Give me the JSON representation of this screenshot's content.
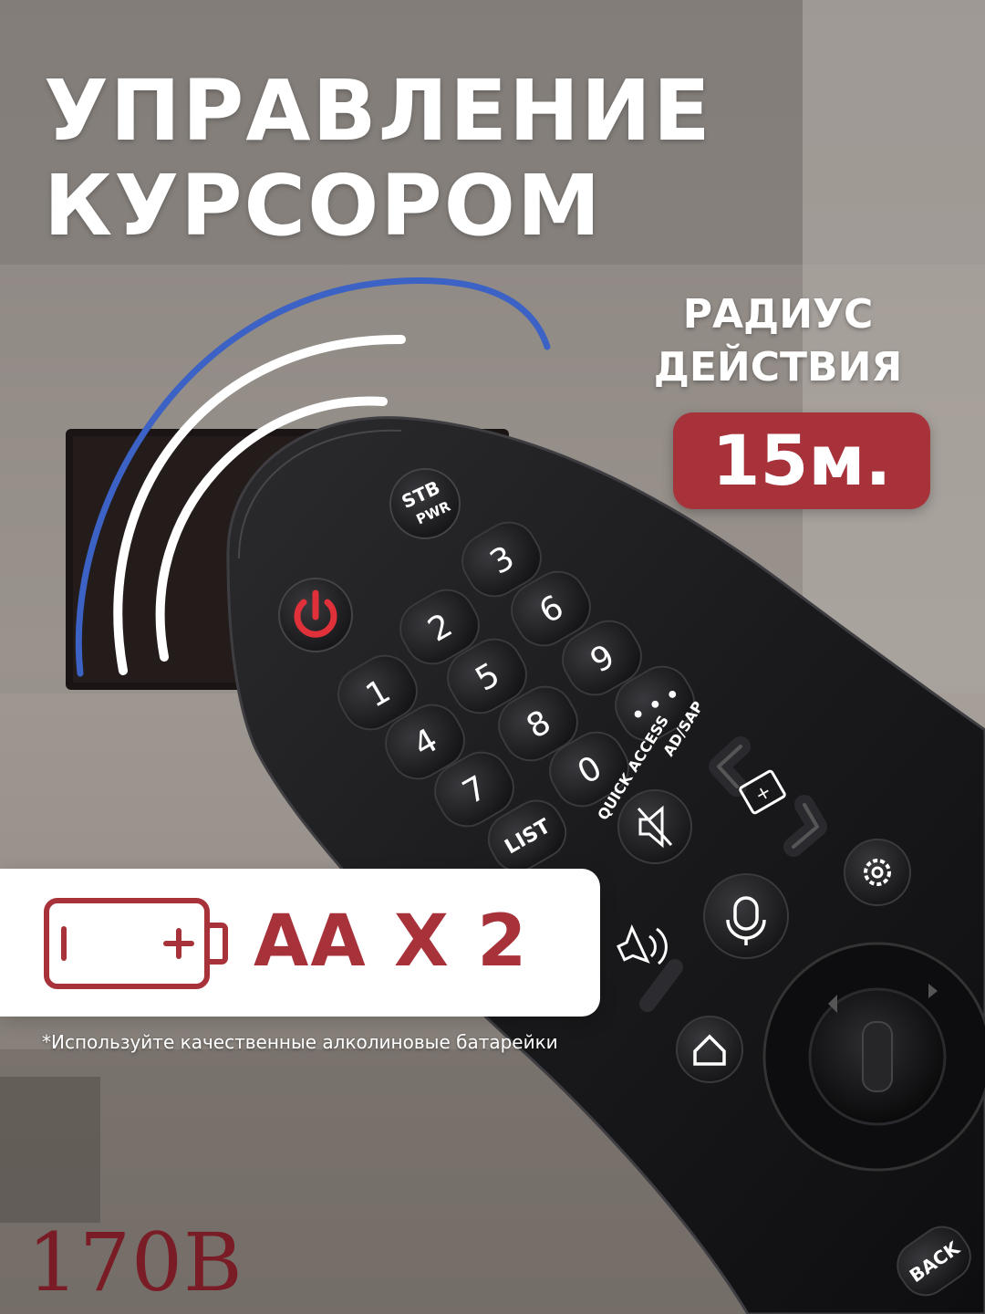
{
  "headline": {
    "line1": "УПРАВЛЕНИЕ",
    "line2": "КУРСОРОМ"
  },
  "range": {
    "label_line1": "РАДИУС",
    "label_line2": "ДЕЙСТВИЯ",
    "value": "15м."
  },
  "battery": {
    "text": "АА Х 2",
    "footnote": "*Используйте качественные алколиновые батарейки"
  },
  "remote": {
    "stb_top": "STB",
    "stb_bottom": "PWR",
    "digits": [
      "1",
      "2",
      "3",
      "4",
      "5",
      "6",
      "7",
      "8",
      "9",
      "0"
    ],
    "more": "• • •",
    "list": "LIST",
    "quick_access": "QUICK ACCESS",
    "ad_sap": "AD/SAP",
    "back": "BACK"
  },
  "watermark": "170B",
  "colors": {
    "accent": "#a8323a",
    "power": "#e0303a",
    "remote_body": "#1a1a1c",
    "background": "#8d8782",
    "wave_blue": "#3b62c4"
  },
  "icons": [
    "battery-icon",
    "power-icon",
    "mute-icon",
    "input-icon",
    "settings-icon",
    "microphone-icon",
    "volume-icon",
    "home-icon",
    "channel-up-icon",
    "channel-down-icon"
  ]
}
